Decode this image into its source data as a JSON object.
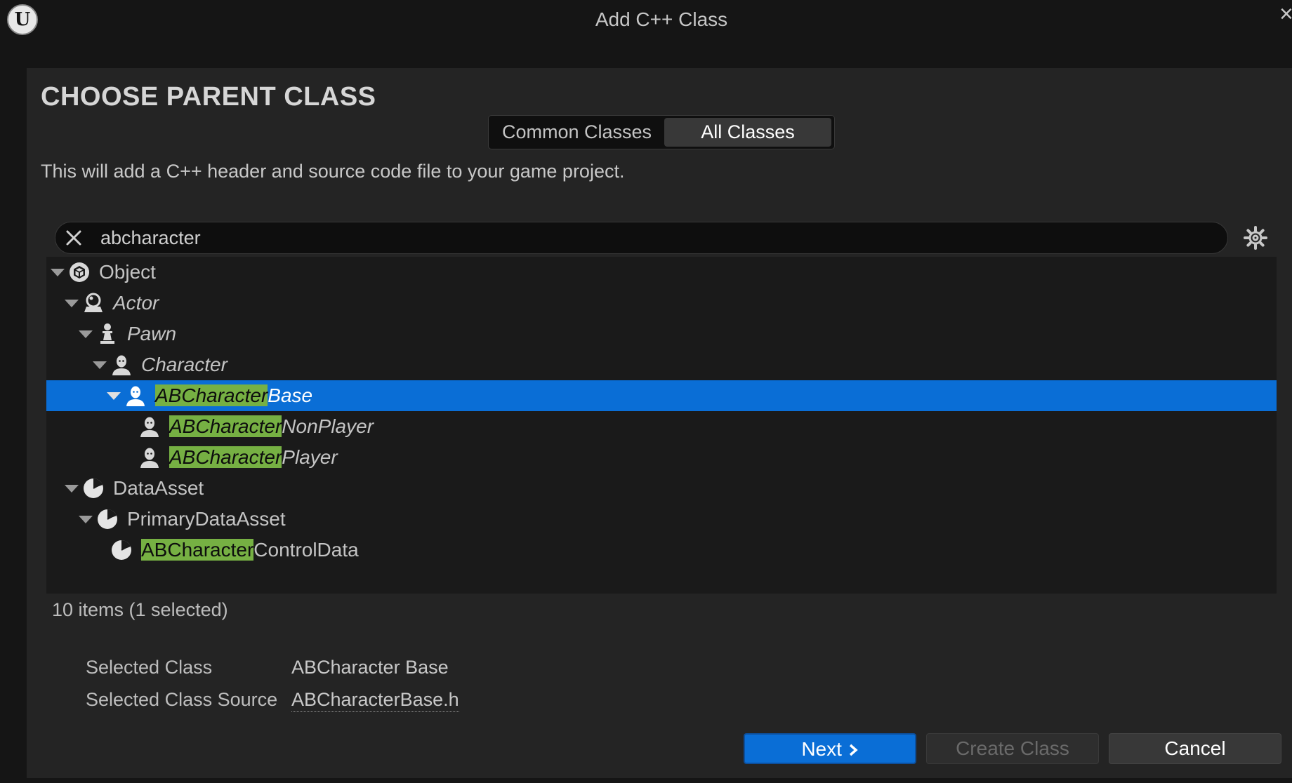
{
  "window": {
    "title": "Add C++ Class",
    "logo_letter": "U",
    "close_glyph": "×"
  },
  "header": {
    "title": "CHOOSE PARENT CLASS",
    "tabs": [
      {
        "label": "Common Classes",
        "active": false
      },
      {
        "label": "All Classes",
        "active": true
      }
    ],
    "description": "This will add a C++ header and source code file to your game project."
  },
  "search": {
    "value": "abcharacter",
    "placeholder": "",
    "clear_icon": "close-icon",
    "settings_icon": "gear-icon"
  },
  "tree": {
    "rows": [
      {
        "highlight": "",
        "rest": "Object",
        "italic": false,
        "expanded": true,
        "icon": "object-icon",
        "selected": false
      },
      {
        "highlight": "",
        "rest": "Actor",
        "italic": true,
        "expanded": true,
        "icon": "actor-icon",
        "selected": false
      },
      {
        "highlight": "",
        "rest": "Pawn",
        "italic": true,
        "expanded": true,
        "icon": "pawn-icon",
        "selected": false
      },
      {
        "highlight": "",
        "rest": "Character",
        "italic": true,
        "expanded": true,
        "icon": "character-icon",
        "selected": false
      },
      {
        "highlight": "ABCharacter",
        "rest": "Base",
        "italic": true,
        "expanded": true,
        "icon": "character-icon",
        "selected": true
      },
      {
        "highlight": "ABCharacter",
        "rest": "NonPlayer",
        "italic": true,
        "expanded": false,
        "icon": "character-icon",
        "selected": false
      },
      {
        "highlight": "ABCharacter",
        "rest": "Player",
        "italic": true,
        "expanded": false,
        "icon": "character-icon",
        "selected": false
      },
      {
        "highlight": "",
        "rest": "DataAsset",
        "italic": false,
        "expanded": true,
        "icon": "data-asset-icon",
        "selected": false
      },
      {
        "highlight": "",
        "rest": "PrimaryDataAsset",
        "italic": false,
        "expanded": true,
        "icon": "data-asset-icon",
        "selected": false
      },
      {
        "highlight": "ABCharacter",
        "rest": "ControlData",
        "italic": false,
        "expanded": false,
        "icon": "data-asset-icon",
        "selected": false
      }
    ]
  },
  "footer": {
    "item_count": "10 items (1 selected)",
    "selected_class_label": "Selected Class",
    "selected_class_value": "ABCharacter Base",
    "selected_source_label": "Selected Class Source",
    "selected_source_value": "ABCharacterBase.h"
  },
  "buttons": {
    "next": "Next",
    "create": "Create Class",
    "cancel": "Cancel"
  },
  "colors": {
    "accent": "#0a6ed6",
    "match_highlight": "#76b043",
    "background": "#242424"
  }
}
